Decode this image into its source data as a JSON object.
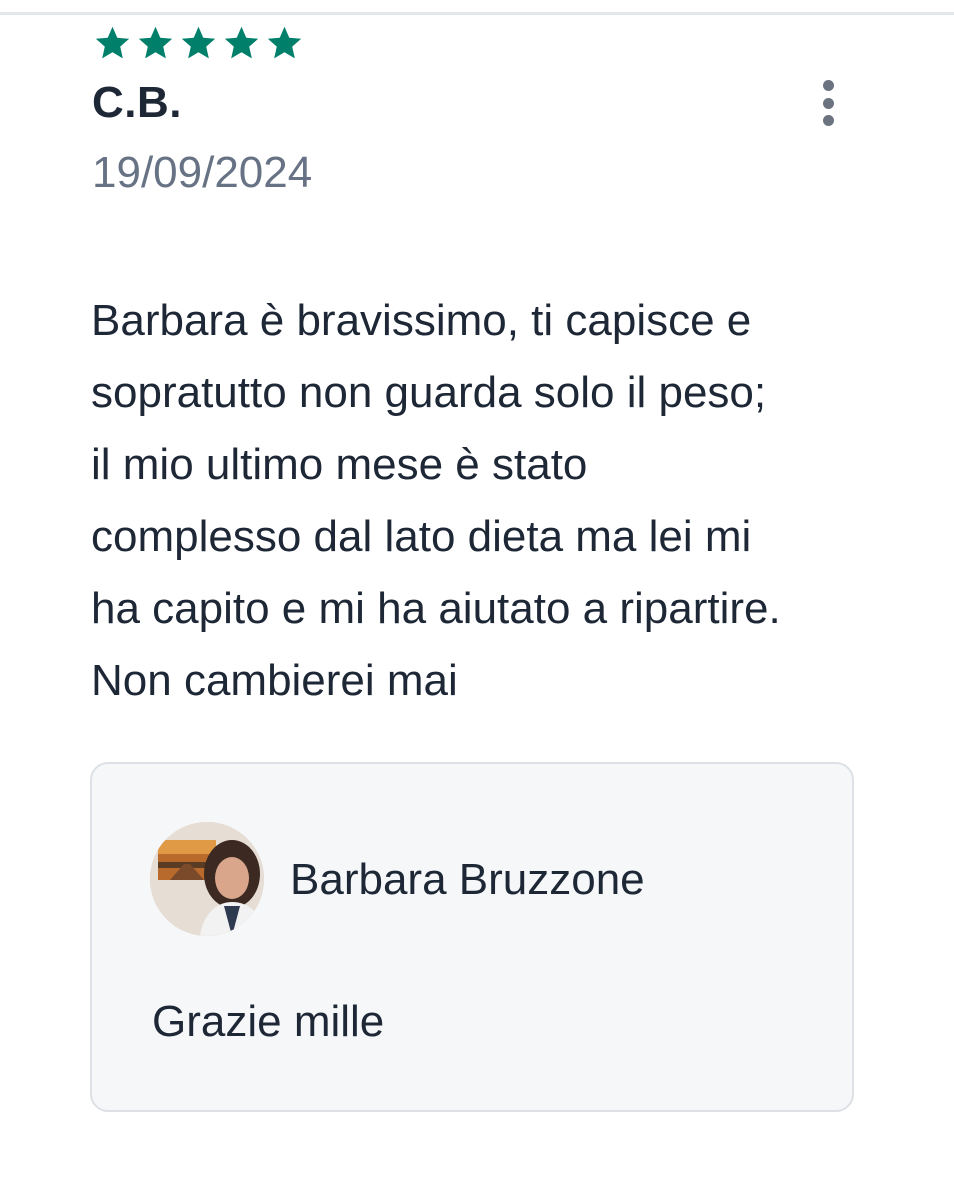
{
  "review": {
    "rating": 5,
    "rating_max": 5,
    "star_color": "#00806a",
    "author": "C.B.",
    "date": "19/09/2024",
    "text_lines": [
      "Barbara è bravissimo, ti capisce e",
      "sopratutto non guarda solo il peso;",
      "il mio ultimo mese è stato",
      "complesso dal lato dieta ma lei mi",
      "ha capito e mi ha aiutato a ripartire.",
      "Non cambierei mai"
    ],
    "more_icon": "more-vertical-icon"
  },
  "reply": {
    "author": "Barbara Bruzzone",
    "text": "Grazie mille"
  }
}
